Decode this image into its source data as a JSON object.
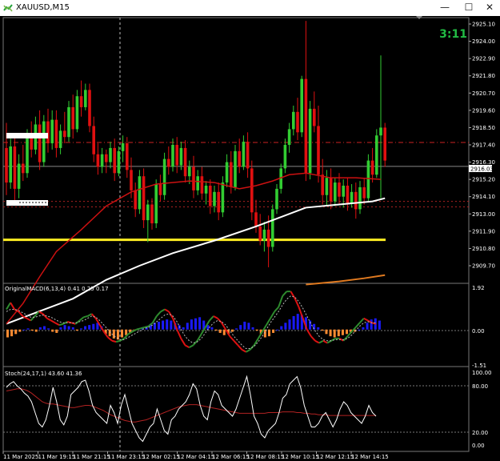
{
  "window": {
    "title": "XAUUSD,M15",
    "minimize_glyph": "—",
    "maximize_glyph": "☐",
    "close_glyph": "✕"
  },
  "main_chart": {
    "countdown": "3:11",
    "price_axis_labels": [
      "2925.10",
      "2924.00",
      "2922.90",
      "2921.80",
      "2920.70",
      "2919.60",
      "2918.50",
      "2917.40",
      "2916.30",
      "2915.20",
      "2914.10",
      "2913.00",
      "2911.90",
      "2910.80",
      "2909.70"
    ],
    "current_price_label": "2916.03"
  },
  "macd": {
    "caption": "OriginalMACD(6,13,4) 0.41 0.25 0.17",
    "axis_labels": [
      "1.92",
      "0.00",
      "-1.51"
    ]
  },
  "stoch": {
    "caption": "Stoch(24,17,1) 43.60 41.36",
    "axis_labels": [
      "100.00",
      "80.00",
      "20.00",
      "0.00"
    ]
  },
  "time_labels": [
    "11 Mar 2025",
    "11 Mar 19:15",
    "11 Mar 21:15",
    "11 Mar 23:15",
    "12 Mar 02:15",
    "12 Mar 04:15",
    "12 Mar 06:15",
    "12 Mar 08:15",
    "12 Mar 10:15",
    "12 Mar 12:15",
    "12 Mar 14:15"
  ],
  "colors": {
    "background": "#000000",
    "bull_candle": "#32cd32",
    "bear_candle": "#e01010",
    "ma_slow": "#ffffff",
    "ma_fast": "#cc1111",
    "support_line": "#ffee22",
    "countdown": "#22bb44",
    "macd_up": "#1a1aff",
    "macd_down": "#ff8c32",
    "grid": "#555555"
  },
  "chart_data": {
    "type": "candlestick",
    "symbol": "XAUUSD",
    "timeframe": "M15",
    "candles": [
      [
        2917.2,
        2918.8,
        2914.2,
        2915.0
      ],
      [
        2915.0,
        2917.8,
        2914.6,
        2917.3
      ],
      [
        2917.3,
        2917.9,
        2913.8,
        2914.6
      ],
      [
        2914.6,
        2916.8,
        2914.0,
        2916.2
      ],
      [
        2916.2,
        2917.4,
        2915.1,
        2915.6
      ],
      [
        2915.6,
        2918.4,
        2915.3,
        2918.0
      ],
      [
        2918.0,
        2918.9,
        2916.6,
        2917.1
      ],
      [
        2917.1,
        2919.2,
        2916.8,
        2918.7
      ],
      [
        2918.7,
        2919.6,
        2915.8,
        2916.3
      ],
      [
        2916.3,
        2919.3,
        2916.0,
        2918.9
      ],
      [
        2918.9,
        2919.7,
        2916.9,
        2917.5
      ],
      [
        2917.5,
        2919.6,
        2917.1,
        2919.0
      ],
      [
        2919.0,
        2919.6,
        2916.6,
        2917.2
      ],
      [
        2917.2,
        2918.7,
        2916.8,
        2918.3
      ],
      [
        2918.3,
        2919.5,
        2917.5,
        2917.9
      ],
      [
        2917.9,
        2920.2,
        2917.6,
        2919.8
      ],
      [
        2919.8,
        2920.6,
        2917.8,
        2918.4
      ],
      [
        2918.4,
        2920.9,
        2918.2,
        2920.5
      ],
      [
        2920.5,
        2921.5,
        2919.2,
        2919.8
      ],
      [
        2919.8,
        2921.3,
        2919.6,
        2920.9
      ],
      [
        2920.9,
        2921.3,
        2918.2,
        2918.6
      ],
      [
        2918.6,
        2919.2,
        2916.3,
        2916.8
      ],
      [
        2916.8,
        2917.5,
        2915.5,
        2916.0
      ],
      [
        2916.0,
        2917.2,
        2915.6,
        2916.8
      ],
      [
        2916.8,
        2917.1,
        2915.6,
        2916.3
      ],
      [
        2916.3,
        2917.6,
        2915.9,
        2917.2
      ],
      [
        2917.2,
        2917.8,
        2915.1,
        2915.6
      ],
      [
        2915.6,
        2917.3,
        2915.4,
        2917.0
      ],
      [
        2917.0,
        2918.0,
        2916.3,
        2917.5
      ],
      [
        2917.5,
        2917.9,
        2915.3,
        2915.8
      ],
      [
        2915.8,
        2916.6,
        2914.0,
        2914.5
      ],
      [
        2914.5,
        2915.0,
        2912.8,
        2913.3
      ],
      [
        2913.3,
        2915.8,
        2913.0,
        2915.4
      ],
      [
        2915.4,
        2915.9,
        2912.1,
        2912.6
      ],
      [
        2912.6,
        2913.9,
        2911.2,
        2913.6
      ],
      [
        2913.6,
        2914.0,
        2912.0,
        2912.4
      ],
      [
        2912.4,
        2915.2,
        2912.1,
        2914.9
      ],
      [
        2914.9,
        2915.5,
        2913.8,
        2914.2
      ],
      [
        2914.2,
        2916.9,
        2913.9,
        2916.5
      ],
      [
        2916.5,
        2917.3,
        2915.5,
        2916.0
      ],
      [
        2916.0,
        2917.8,
        2915.7,
        2917.4
      ],
      [
        2917.4,
        2917.9,
        2915.6,
        2916.1
      ],
      [
        2916.1,
        2917.6,
        2915.8,
        2917.2
      ],
      [
        2917.2,
        2917.7,
        2915.0,
        2915.4
      ],
      [
        2915.4,
        2916.4,
        2914.9,
        2916.0
      ],
      [
        2916.0,
        2916.7,
        2914.0,
        2914.5
      ],
      [
        2914.5,
        2915.8,
        2914.2,
        2915.4
      ],
      [
        2915.4,
        2916.0,
        2913.9,
        2914.3
      ],
      [
        2914.3,
        2915.1,
        2913.6,
        2914.8
      ],
      [
        2914.8,
        2915.2,
        2913.0,
        2913.5
      ],
      [
        2913.5,
        2914.8,
        2913.1,
        2914.4
      ],
      [
        2914.4,
        2915.0,
        2912.6,
        2913.1
      ],
      [
        2913.1,
        2915.4,
        2912.8,
        2915.0
      ],
      [
        2915.0,
        2916.8,
        2914.7,
        2916.3
      ],
      [
        2916.3,
        2917.0,
        2914.3,
        2914.7
      ],
      [
        2914.7,
        2917.4,
        2914.5,
        2917.0
      ],
      [
        2917.0,
        2917.8,
        2915.6,
        2916.0
      ],
      [
        2916.0,
        2918.0,
        2915.8,
        2917.6
      ],
      [
        2917.6,
        2918.2,
        2915.3,
        2915.9
      ],
      [
        2915.9,
        2916.4,
        2912.6,
        2913.1
      ],
      [
        2913.1,
        2913.9,
        2911.8,
        2912.2
      ],
      [
        2912.2,
        2913.0,
        2911.0,
        2911.3
      ],
      [
        2911.3,
        2912.5,
        2910.6,
        2912.0
      ],
      [
        2912.0,
        2912.9,
        2909.6,
        2910.9
      ],
      [
        2910.9,
        2913.6,
        2910.6,
        2913.3
      ],
      [
        2913.3,
        2914.9,
        2913.0,
        2914.6
      ],
      [
        2914.6,
        2916.2,
        2914.3,
        2915.9
      ],
      [
        2915.9,
        2917.8,
        2915.6,
        2917.4
      ],
      [
        2917.4,
        2918.8,
        2916.9,
        2918.4
      ],
      [
        2918.4,
        2919.9,
        2918.0,
        2919.5
      ],
      [
        2919.5,
        2920.4,
        2917.7,
        2918.2
      ],
      [
        2918.2,
        2921.8,
        2917.9,
        2921.6
      ],
      [
        2921.6,
        2925.3,
        2915.1,
        2915.6
      ],
      [
        2915.6,
        2920.2,
        2915.2,
        2919.7
      ],
      [
        2919.7,
        2920.8,
        2918.2,
        2918.6
      ],
      [
        2918.6,
        2919.9,
        2915.0,
        2915.5
      ],
      [
        2915.5,
        2916.5,
        2913.6,
        2914.2
      ],
      [
        2914.2,
        2915.8,
        2913.5,
        2915.3
      ],
      [
        2915.3,
        2915.9,
        2913.3,
        2913.8
      ],
      [
        2913.8,
        2915.3,
        2913.5,
        2915.0
      ],
      [
        2915.0,
        2915.6,
        2913.6,
        2914.1
      ],
      [
        2914.1,
        2915.2,
        2913.4,
        2914.8
      ],
      [
        2914.8,
        2915.3,
        2913.2,
        2913.7
      ],
      [
        2913.7,
        2914.9,
        2913.4,
        2914.4
      ],
      [
        2914.4,
        2915.0,
        2912.7,
        2913.3
      ],
      [
        2913.3,
        2915.1,
        2913.0,
        2914.7
      ],
      [
        2914.7,
        2915.3,
        2913.6,
        2914.0
      ],
      [
        2914.0,
        2916.8,
        2913.8,
        2916.4
      ],
      [
        2916.4,
        2917.2,
        2915.0,
        2915.5
      ],
      [
        2915.5,
        2918.4,
        2915.3,
        2918.0
      ],
      [
        2918.0,
        2923.1,
        2914.0,
        2918.5
      ],
      [
        2918.5,
        2918.8,
        2916.0,
        2916.4
      ]
    ],
    "ma_slow_points": [
      [
        0,
        2906.0
      ],
      [
        8,
        2906.8
      ],
      [
        16,
        2907.6
      ],
      [
        24,
        2908.8
      ],
      [
        32,
        2909.7
      ],
      [
        40,
        2910.5
      ],
      [
        50,
        2911.3
      ],
      [
        60,
        2912.2
      ],
      [
        66,
        2912.8
      ],
      [
        72,
        2913.4
      ],
      [
        80,
        2913.6
      ],
      [
        88,
        2913.8
      ],
      [
        91,
        2914.0
      ]
    ],
    "ma_fast_points": [
      [
        0,
        2906.0
      ],
      [
        4,
        2907.3
      ],
      [
        8,
        2909.0
      ],
      [
        12,
        2910.6
      ],
      [
        18,
        2912.0
      ],
      [
        24,
        2913.5
      ],
      [
        30,
        2914.4
      ],
      [
        36,
        2914.9
      ],
      [
        44,
        2915.1
      ],
      [
        50,
        2915.0
      ],
      [
        56,
        2914.6
      ],
      [
        60,
        2914.8
      ],
      [
        64,
        2915.1
      ],
      [
        68,
        2915.5
      ],
      [
        72,
        2915.6
      ],
      [
        78,
        2915.3
      ],
      [
        84,
        2915.3
      ],
      [
        90,
        2915.2
      ]
    ],
    "ma_long_points": [
      [
        72,
        2908.5
      ],
      [
        80,
        2908.7
      ],
      [
        86,
        2908.9
      ],
      [
        91,
        2909.1
      ]
    ],
    "support_price": 2911.35,
    "resistance_dotted_price": 2917.55,
    "bid_line_price": 2916.03,
    "low_dashed_prices": [
      2913.8,
      2913.45
    ],
    "macd_hist": [
      -0.35,
      -0.3,
      -0.2,
      -0.1,
      0.0,
      0.05,
      -0.05,
      -0.1,
      0.1,
      0.15,
      0.05,
      -0.1,
      -0.15,
      0.1,
      0.2,
      0.15,
      0.1,
      -0.05,
      0.05,
      0.15,
      0.2,
      0.25,
      0.3,
      0.15,
      -0.2,
      -0.3,
      -0.4,
      -0.45,
      -0.35,
      -0.25,
      -0.15,
      -0.05,
      0.05,
      0.1,
      0.15,
      0.25,
      0.3,
      0.35,
      0.4,
      0.45,
      0.4,
      0.3,
      0.2,
      0.1,
      0.3,
      0.45,
      0.5,
      0.55,
      0.4,
      0.2,
      0.1,
      -0.05,
      -0.15,
      -0.25,
      -0.2,
      -0.1,
      0.05,
      0.2,
      0.35,
      0.3,
      0.1,
      -0.05,
      -0.2,
      -0.35,
      -0.3,
      -0.15,
      0.0,
      0.15,
      0.3,
      0.45,
      0.6,
      0.7,
      0.65,
      0.55,
      0.4,
      0.25,
      0.1,
      -0.05,
      -0.2,
      -0.3,
      -0.35,
      -0.3,
      -0.25,
      -0.2,
      -0.15,
      -0.1,
      0.0,
      0.1,
      0.3,
      0.45,
      0.5,
      0.4
    ],
    "macd_line": [
      0.9,
      1.2,
      0.9,
      0.8,
      0.6,
      0.5,
      0.4,
      0.6,
      0.8,
      0.7,
      0.5,
      0.4,
      0.3,
      0.2,
      0.25,
      0.35,
      0.3,
      0.25,
      0.4,
      0.55,
      0.6,
      0.7,
      0.5,
      0.2,
      -0.1,
      -0.35,
      -0.5,
      -0.55,
      -0.5,
      -0.4,
      -0.2,
      -0.1,
      0.0,
      0.05,
      0.1,
      0.15,
      0.3,
      0.6,
      0.8,
      0.9,
      0.8,
      0.5,
      0.0,
      -0.4,
      -0.7,
      -0.8,
      -0.7,
      -0.5,
      -0.2,
      0.1,
      0.4,
      0.6,
      0.5,
      0.3,
      0.0,
      -0.3,
      -0.5,
      -0.7,
      -0.9,
      -1.0,
      -0.9,
      -0.7,
      -0.4,
      -0.1,
      0.2,
      0.5,
      0.8,
      1.0,
      1.5,
      1.7,
      1.7,
      1.4,
      1.0,
      0.5,
      0.0,
      -0.3,
      -0.5,
      -0.6,
      -0.5,
      -0.6,
      -0.5,
      -0.4,
      -0.4,
      -0.5,
      -0.3,
      -0.1,
      0.1,
      0.3,
      0.5,
      0.4,
      0.3,
      0.25
    ],
    "macd_signal": [
      0.8,
      0.9,
      0.9,
      0.85,
      0.75,
      0.65,
      0.55,
      0.55,
      0.6,
      0.65,
      0.6,
      0.55,
      0.45,
      0.35,
      0.3,
      0.3,
      0.3,
      0.3,
      0.35,
      0.4,
      0.5,
      0.6,
      0.55,
      0.4,
      0.2,
      0.0,
      -0.2,
      -0.35,
      -0.45,
      -0.45,
      -0.35,
      -0.25,
      -0.15,
      -0.05,
      0.05,
      0.1,
      0.2,
      0.35,
      0.5,
      0.65,
      0.7,
      0.6,
      0.35,
      0.0,
      -0.3,
      -0.5,
      -0.6,
      -0.55,
      -0.4,
      -0.15,
      0.1,
      0.3,
      0.4,
      0.35,
      0.2,
      -0.05,
      -0.3,
      -0.5,
      -0.7,
      -0.85,
      -0.85,
      -0.75,
      -0.55,
      -0.3,
      0.0,
      0.3,
      0.55,
      0.8,
      1.1,
      1.35,
      1.5,
      1.45,
      1.25,
      0.95,
      0.6,
      0.25,
      -0.05,
      -0.3,
      -0.45,
      -0.5,
      -0.5,
      -0.45,
      -0.45,
      -0.45,
      -0.4,
      -0.25,
      -0.05,
      0.15,
      0.3,
      0.35,
      0.3,
      0.3
    ],
    "stoch_k": [
      80,
      85,
      88,
      82,
      78,
      72,
      68,
      60,
      45,
      30,
      25,
      35,
      55,
      80,
      60,
      35,
      28,
      40,
      70,
      75,
      80,
      88,
      90,
      75,
      55,
      45,
      40,
      35,
      30,
      55,
      45,
      30,
      55,
      70,
      50,
      30,
      20,
      10,
      5,
      15,
      25,
      30,
      50,
      35,
      20,
      15,
      35,
      40,
      50,
      55,
      60,
      70,
      85,
      78,
      55,
      40,
      35,
      60,
      75,
      70,
      55,
      50,
      45,
      40,
      50,
      65,
      80,
      95,
      70,
      40,
      30,
      15,
      10,
      20,
      25,
      30,
      45,
      65,
      70,
      85,
      90,
      95,
      80,
      55,
      40,
      25,
      25,
      30,
      40,
      45,
      35,
      25,
      35,
      50,
      60,
      55,
      45,
      40,
      35,
      30,
      40,
      55,
      45,
      40
    ],
    "stoch_signal": [
      75,
      76,
      77,
      78,
      78,
      77,
      75,
      72,
      68,
      64,
      60,
      58,
      57,
      57,
      56,
      55,
      54,
      53,
      52,
      52,
      53,
      54,
      55,
      55,
      54,
      52,
      50,
      48,
      45,
      42,
      40,
      38,
      36,
      34,
      33,
      32,
      32,
      33,
      34,
      35,
      37,
      39,
      41,
      43,
      45,
      47,
      49,
      51,
      53,
      54,
      55,
      56,
      56,
      56,
      55,
      54,
      53,
      52,
      51,
      50,
      49,
      48,
      47,
      46,
      45,
      44,
      44,
      44,
      44,
      44,
      44,
      44,
      44,
      45,
      45,
      45,
      45,
      46,
      46,
      46,
      46,
      45,
      45,
      44,
      44,
      43,
      43,
      42,
      42,
      42,
      41,
      41,
      41,
      41,
      41,
      41,
      41,
      41,
      41,
      41,
      41,
      41,
      41,
      41
    ]
  }
}
